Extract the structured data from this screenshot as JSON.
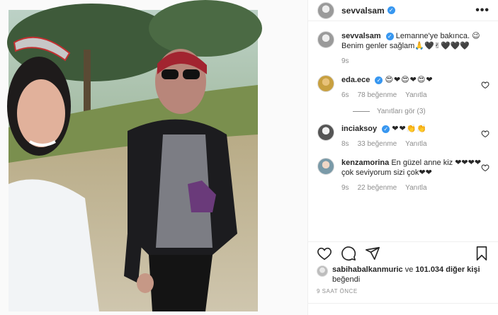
{
  "post": {
    "username": "sevvalsam",
    "verified": true
  },
  "caption": {
    "username": "sevvalsam",
    "line1": "Lemanne'ye bakınca. 😉",
    "line2": "Benim genler sağlam🙏🖤✌🖤🖤🖤",
    "time": "9s"
  },
  "comments": [
    {
      "username": "eda.ece",
      "verified": true,
      "text": "😍❤😍❤😍❤",
      "time": "6s",
      "likes": "78 beğenme",
      "reply": "Yanıtla"
    },
    {
      "username": "inciaksoy",
      "verified": true,
      "text": "❤❤👏👏",
      "time": "8s",
      "likes": "33 beğenme",
      "reply": "Yanıtla"
    },
    {
      "username": "kenzamorina",
      "verified": false,
      "text": "En güzel anne kiz ❤❤❤❤ çok seviyorum sizi çok❤❤",
      "time": "9s",
      "likes": "22 beğenme",
      "reply": "Yanıtla"
    }
  ],
  "replies_label": "Yanıtları gör (3)",
  "likes": {
    "first_user": "sabihabalkanmuric",
    "connector": "ve",
    "count": "101.034 diğer kişi",
    "suffix": "beğendi"
  },
  "timestamp": "9 SAAT ÖNCE",
  "icons": {
    "like": "heart-icon",
    "comment": "comment-icon",
    "share": "share-icon",
    "save": "bookmark-icon",
    "more": "more-icon"
  },
  "colors": {
    "verified": "#3897f0",
    "muted": "#8e8e8e",
    "text": "#262626",
    "divider": "#efefef"
  }
}
